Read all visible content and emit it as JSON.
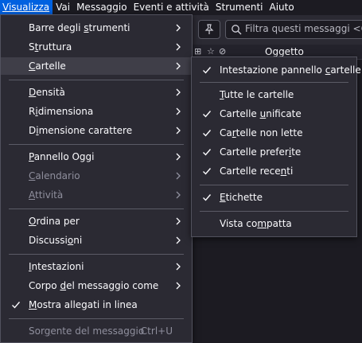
{
  "menubar": [
    {
      "label": "Visualizza",
      "active": true
    },
    {
      "label": "Vai"
    },
    {
      "label": "Messaggio"
    },
    {
      "label": "Eventi e attività"
    },
    {
      "label": "Strumenti"
    },
    {
      "label": "Aiuto"
    }
  ],
  "toolbar": {
    "pin_icon": "pin-icon",
    "search_placeholder": "Filtra questi messaggi <Ctrl+"
  },
  "thread_header": {
    "subject_label": "Oggetto"
  },
  "view_menu": {
    "items": [
      {
        "pre": "Barre degli ",
        "key": "s",
        "post": "trumenti",
        "submenu": true
      },
      {
        "pre": "S",
        "key": "t",
        "post": "ruttura",
        "submenu": true
      },
      {
        "pre": "",
        "key": "C",
        "post": "artelle",
        "submenu": true,
        "hover": true
      },
      {
        "pre": "",
        "key": "D",
        "post": "ensità",
        "submenu": true
      },
      {
        "pre": "R",
        "key": "i",
        "post": "dimensiona",
        "submenu": true
      },
      {
        "pre": "D",
        "key": "i",
        "post": "mensione carattere",
        "submenu": true
      },
      {
        "pre": "",
        "key": "P",
        "post": "annello Oggi",
        "submenu": true
      },
      {
        "pre": "",
        "key": "C",
        "post": "alendario",
        "submenu": true,
        "disabled": true
      },
      {
        "pre": "",
        "key": "A",
        "post": "ttività",
        "submenu": true,
        "disabled": true
      },
      {
        "pre": "",
        "key": "O",
        "post": "rdina per",
        "submenu": true
      },
      {
        "pre": "Discussi",
        "key": "o",
        "post": "ni",
        "submenu": true
      },
      {
        "pre": "",
        "key": "I",
        "post": "ntestazioni",
        "submenu": true
      },
      {
        "pre": "Corpo ",
        "key": "d",
        "post": "el messaggio come",
        "submenu": true
      },
      {
        "pre": "",
        "key": "M",
        "post": "ostra allegati in linea",
        "checked": true
      },
      {
        "pre": "Sor",
        "key": "g",
        "post": "ente del messaggio",
        "shortcut": "Ctrl+U",
        "disabled": true
      }
    ]
  },
  "folders_submenu": {
    "items": [
      {
        "pre": "Intestazione pannello ",
        "key": "c",
        "post": "artelle",
        "checked": true
      },
      {
        "pre": "",
        "key": "T",
        "post": "utte le cartelle"
      },
      {
        "pre": "Cartelle ",
        "key": "u",
        "post": "nificate",
        "checked": true
      },
      {
        "pre": "Ca",
        "key": "r",
        "post": "telle non lette",
        "checked": true
      },
      {
        "pre": "Cartelle prefer",
        "key": "i",
        "post": "te",
        "checked": true
      },
      {
        "pre": "Cartelle rece",
        "key": "n",
        "post": "ti",
        "checked": true
      },
      {
        "pre": "",
        "key": "E",
        "post": "tichette",
        "checked": true
      },
      {
        "pre": "Vista co",
        "key": "m",
        "post": "patta"
      }
    ]
  },
  "colors": {
    "menu_bg": "#2b2a33",
    "app_bg": "#1c1b22",
    "accent": "#0061e0",
    "hover": "#3f3e48",
    "disabled_text": "#8f8f9d"
  }
}
